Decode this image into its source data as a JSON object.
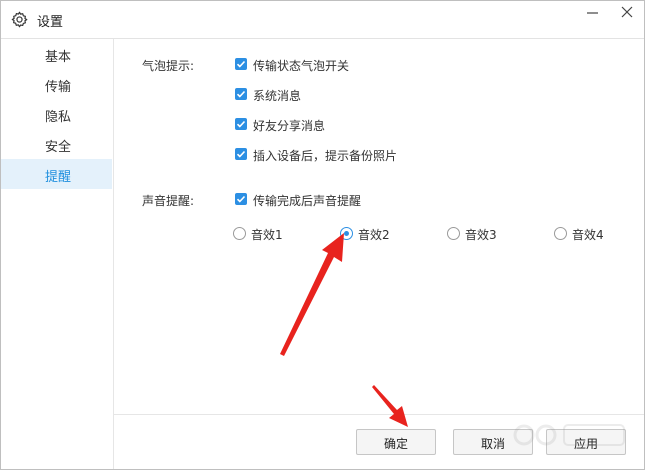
{
  "window": {
    "title": "设置"
  },
  "sidebar": {
    "items": [
      {
        "label": "基本",
        "active": false
      },
      {
        "label": "传输",
        "active": false
      },
      {
        "label": "隐私",
        "active": false
      },
      {
        "label": "安全",
        "active": false
      },
      {
        "label": "提醒",
        "active": true
      }
    ]
  },
  "bubble": {
    "label": "气泡提示:",
    "options": [
      {
        "label": "传输状态气泡开关",
        "checked": true
      },
      {
        "label": "系统消息",
        "checked": true
      },
      {
        "label": "好友分享消息",
        "checked": true
      },
      {
        "label": "插入设备后，提示备份照片",
        "checked": true
      }
    ]
  },
  "sound": {
    "label": "声音提醒:",
    "option": {
      "label": "传输完成后声音提醒",
      "checked": true
    },
    "effects": [
      {
        "label": "音效1",
        "selected": false
      },
      {
        "label": "音效2",
        "selected": true
      },
      {
        "label": "音效3",
        "selected": false
      },
      {
        "label": "音效4",
        "selected": false
      }
    ]
  },
  "footer": {
    "confirm_label": "确定",
    "cancel_label": "取消",
    "apply_label": "应用"
  },
  "colors": {
    "accent": "#2c8fe3",
    "active_nav_bg": "#e4f1fb",
    "annotation_arrow": "#e8231e"
  },
  "icons": {
    "title": "gear-icon",
    "minimize": "minimize-icon",
    "close": "close-icon",
    "checkbox": "checkmark-icon"
  }
}
